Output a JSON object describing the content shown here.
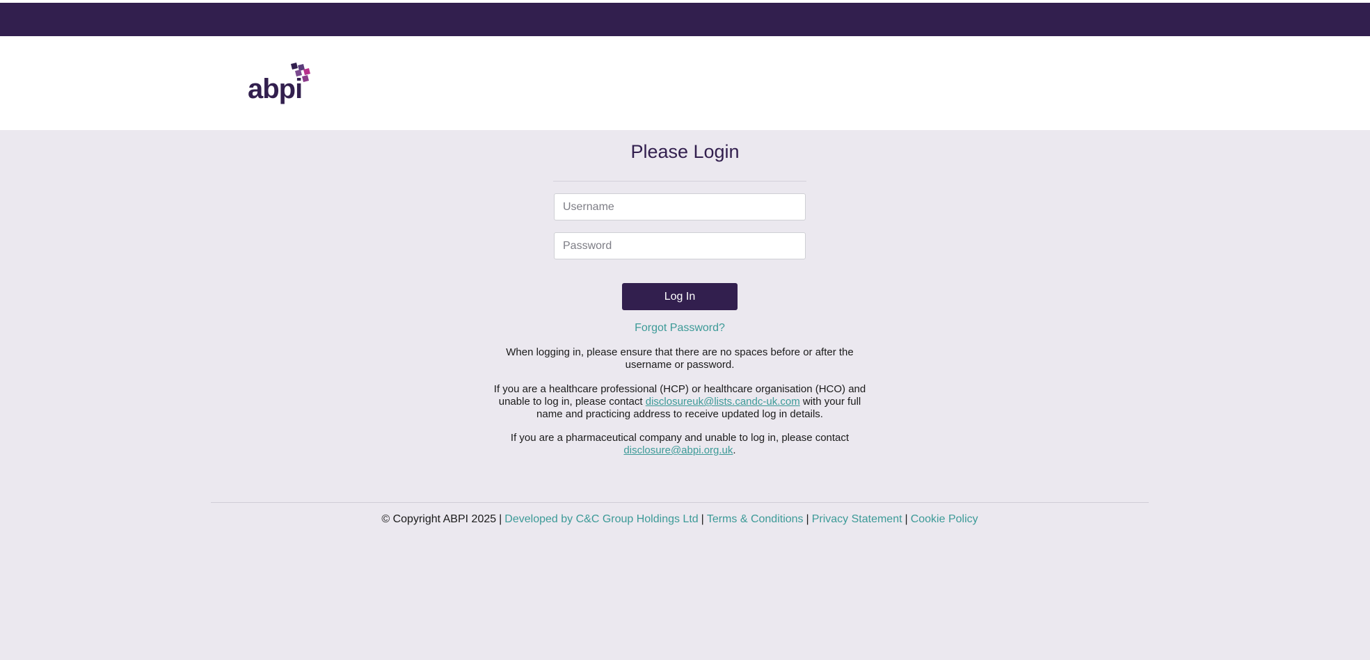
{
  "brand": {
    "name": "abpi",
    "accent_color": "#321f4e",
    "logo_mark_colors": [
      "#321f4e",
      "#b8308c"
    ]
  },
  "login": {
    "title": "Please Login",
    "username_placeholder": "Username",
    "password_placeholder": "Password",
    "login_button": "Log In",
    "forgot_password": "Forgot Password?"
  },
  "info": {
    "spaces_notice": "When logging in, please ensure that there are no spaces before or after the username or password.",
    "hcp_text_before": "If you are a healthcare professional (HCP) or healthcare organisation (HCO) and unable to log in, please contact ",
    "hcp_email": "disclosureuk@lists.candc-uk.com",
    "hcp_text_after": " with your full name and practicing address to receive updated log in details.",
    "pharma_text_before": "If you are a pharmaceutical company and unable to log in, please contact ",
    "pharma_email": "disclosure@abpi.org.uk",
    "pharma_text_after": "."
  },
  "footer": {
    "copyright": "© Copyright ABPI 2025",
    "separator": "|",
    "developed_by": "Developed by C&C Group Holdings Ltd",
    "terms": "Terms & Conditions",
    "privacy": "Privacy Statement",
    "cookie": "Cookie Policy"
  }
}
